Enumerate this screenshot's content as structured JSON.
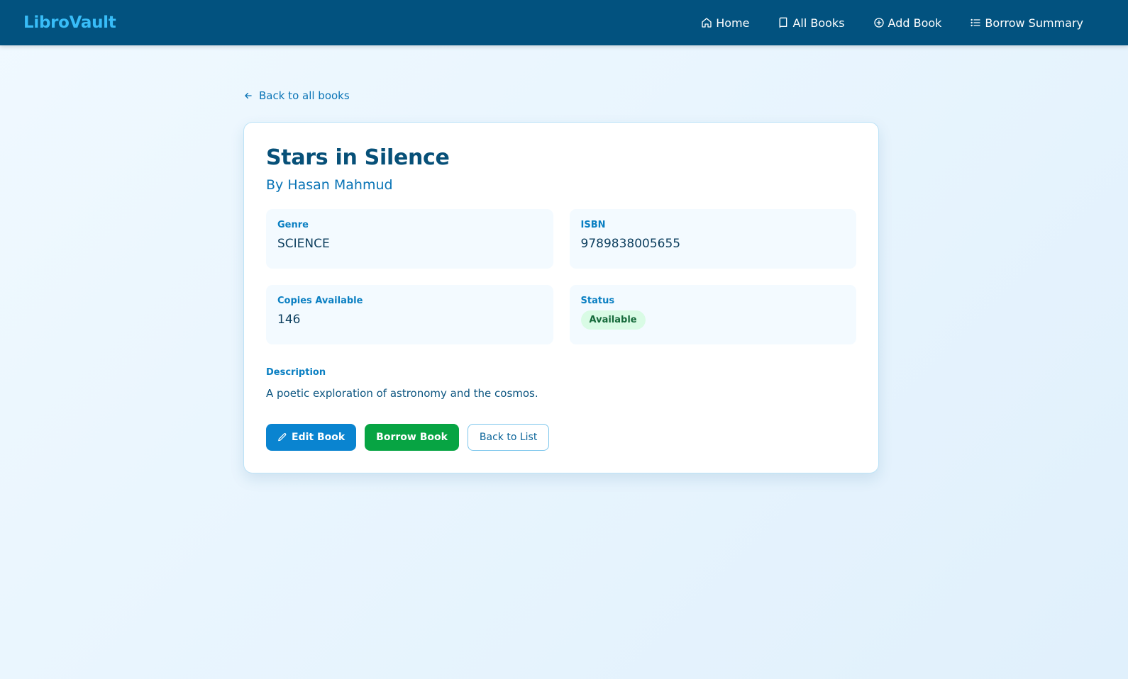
{
  "nav": {
    "brand": "LibroVault",
    "links": [
      {
        "label": "Home",
        "icon": "home-icon"
      },
      {
        "label": "All Books",
        "icon": "book-icon"
      },
      {
        "label": "Add Book",
        "icon": "plus-circle-icon"
      },
      {
        "label": "Borrow Summary",
        "icon": "list-icon"
      }
    ]
  },
  "back_link": "Back to all books",
  "book": {
    "title": "Stars in Silence",
    "author": "By Hasan Mahmud",
    "genre_label": "Genre",
    "genre": "SCIENCE",
    "isbn_label": "ISBN",
    "isbn": "9789838005655",
    "copies_label": "Copies Available",
    "copies": "146",
    "status_label": "Status",
    "status": "Available",
    "description_label": "Description",
    "description": "A poetic exploration of astronomy and the cosmos."
  },
  "actions": {
    "edit": "Edit Book",
    "borrow": "Borrow Book",
    "back": "Back to List"
  },
  "colors": {
    "navbar": "#02527f",
    "brand": "#38bdf8",
    "edit_button": "#0a84d0",
    "borrow_button": "#07a443",
    "status_badge_bg": "#d9fbe5"
  }
}
